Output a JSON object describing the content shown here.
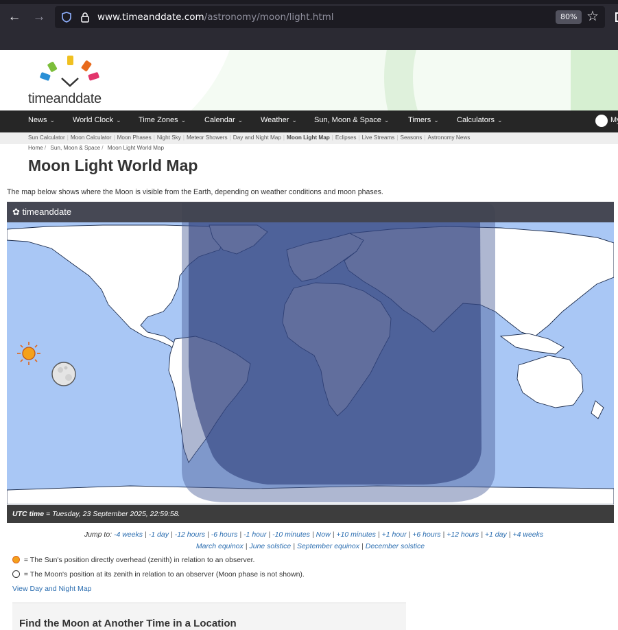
{
  "browser": {
    "url_domain": "www.timeanddate.com",
    "url_path": "/astronomy/moon/light.html",
    "zoom": "80%"
  },
  "site": {
    "logo_text_a": "time",
    "logo_text_b": "and",
    "logo_text_c": "date",
    "map_logo": "timeanddate"
  },
  "nav": {
    "items": [
      "News",
      "World Clock",
      "Time Zones",
      "Calendar",
      "Weather",
      "Sun, Moon & Space",
      "Timers",
      "Calculators"
    ],
    "account": "My"
  },
  "subnav": {
    "items": [
      "Sun Calculator",
      "Moon Calculator",
      "Moon Phases",
      "Night Sky",
      "Meteor Showers",
      "Day and Night Map",
      "Moon Light Map",
      "Eclipses",
      "Live Streams",
      "Seasons",
      "Astronomy News"
    ],
    "active": "Moon Light Map"
  },
  "breadcrumb": [
    "Home",
    "Sun, Moon & Space",
    "Moon Light World Map"
  ],
  "page": {
    "title": "Moon Light World Map",
    "intro": "The map below shows where the Moon is visible from the Earth, depending on weather conditions and moon phases."
  },
  "utc": {
    "label": "UTC time",
    "value": " = Tuesday, 23 September 2025, 22:59:58."
  },
  "jump": {
    "label": "Jump to: ",
    "links": [
      "-4 weeks",
      "-1 day",
      "-12 hours",
      "-6 hours",
      "-1 hour",
      "-10 minutes",
      "Now",
      "+10 minutes",
      "+1 hour",
      "+6 hours",
      "+12 hours",
      "+1 day",
      "+4 weeks"
    ],
    "equinox_links": [
      "March equinox",
      "June solstice",
      "September equinox",
      "December solstice"
    ]
  },
  "legend": {
    "sun": " = The Sun's position directly overhead (zenith) in relation to an observer.",
    "moon": " = The Moon's position at its zenith in relation to an observer (Moon phase is not shown)."
  },
  "view_link": "View Day and Night Map",
  "find_title": "Find the Moon at Another Time in a Location",
  "colors": {
    "ocean": "#a9c7f5",
    "land": "#ffffff",
    "moonlit": "#3f4f8d",
    "nav_bg": "#262626",
    "link": "#2a6db0"
  }
}
